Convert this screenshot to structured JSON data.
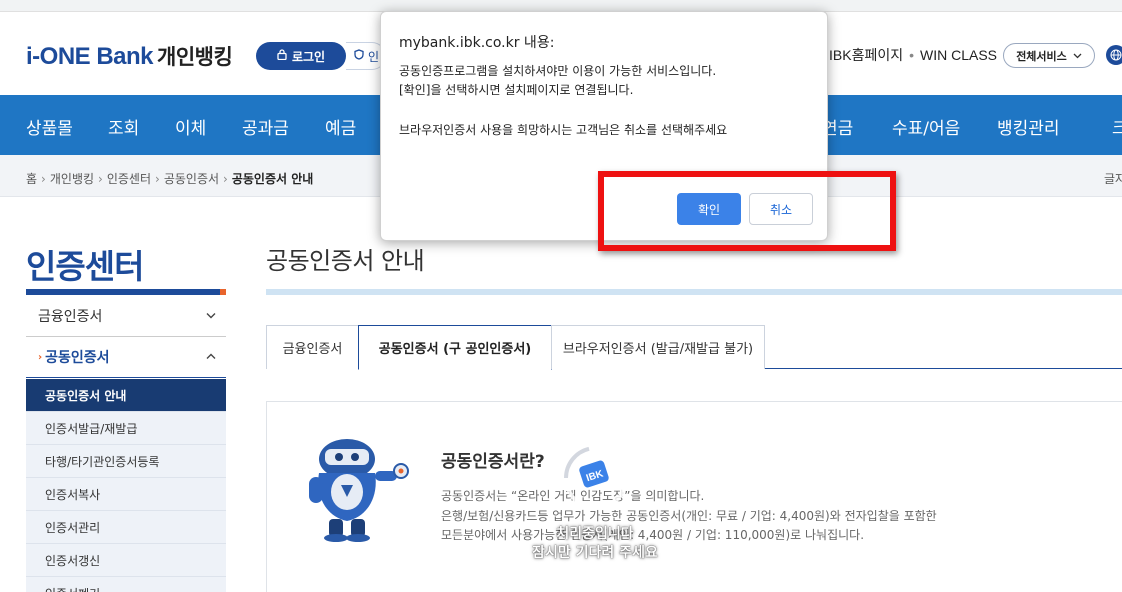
{
  "header": {
    "logo_text": "i-ONE Bank",
    "logo_sub": "개인뱅킹",
    "login_label": "로그인",
    "cert_label": "인",
    "util_link1": "IBK홈페이지",
    "util_link2": "WIN CLASS",
    "all_services": "전체서비스",
    "brand_color": "#1d4b9a"
  },
  "nav": {
    "color": "#1f76c4",
    "items": [
      "상품몰",
      "조회",
      "이체",
      "공과금",
      "예금",
      "연금",
      "수표/어음",
      "뱅킹관리",
      "크"
    ]
  },
  "breadcrumb": {
    "items": [
      "홈",
      "개인뱅킹",
      "인증센터",
      "공동인증서"
    ],
    "current": "공동인증서 안내",
    "right": "글자"
  },
  "sidebar": {
    "title": "인증센터",
    "groups": [
      "금융인증서",
      "공동인증서"
    ],
    "sub_items": [
      "공동인증서 안내",
      "인증서발급/재발급",
      "타행/타기관인증서등록",
      "인증서복사",
      "인증서관리",
      "인증서갱신",
      "인증서폐기"
    ]
  },
  "main": {
    "title": "공동인증서 안내",
    "tabs": [
      "금융인증서",
      "공동인증서 (구 공인인증서)",
      "브라우저인증서 (발급/재발급 불가)"
    ],
    "intro_heading": "공동인증서란?",
    "intro_line1": "공동인증서는 “온라인 거래 인감도장”을 의미합니다.",
    "intro_line2": "은행/보험/신용카드등 업무가 가능한 공동인증서(개인: 무료 / 기업: 4,400원)와 전자입찰을 포함한",
    "intro_line3": "모든분야에서 사용가능한 인증서(개인: 4,400원 / 기업: 110,000원)로 나눠집니다."
  },
  "dialog": {
    "title": "mybank.ibk.co.kr 내용:",
    "line1": "공동인증프로그램을 설치하셔야만 이용이 가능한 서비스입니다.",
    "line2": "[확인]을 선택하시면 설치페이지로 연결됩니다.",
    "line3": "브라우저인증서 사용을 희망하시는 고객님은 취소를 선택해주세요",
    "ok_label": "확인",
    "cancel_label": "취소"
  },
  "loading": {
    "badge": "IBK",
    "line1": "처리중입니다",
    "line2": "잠시만 기다려 주세요"
  }
}
